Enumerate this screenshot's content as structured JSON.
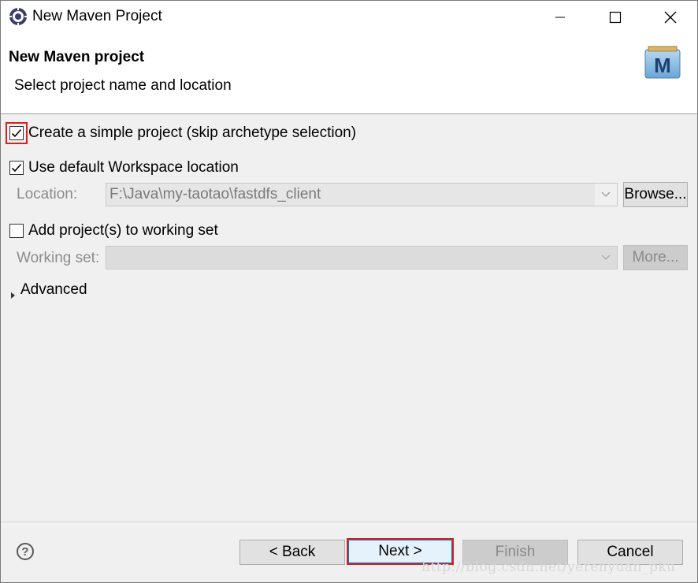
{
  "window": {
    "title": "New Maven Project",
    "controls": {
      "minimize": "—",
      "maximize": "☐",
      "close": "✕"
    }
  },
  "header": {
    "title": "New Maven project",
    "description": "Select project name and location",
    "icon_letter": "M"
  },
  "options": {
    "simple_project": {
      "label": "Create a simple project (skip archetype selection)",
      "checked": true
    },
    "default_workspace": {
      "label": "Use default Workspace location",
      "checked": true
    },
    "location": {
      "label": "Location:",
      "value": "F:\\Java\\my-taotao\\fastdfs_client",
      "browse_label": "Browse..."
    },
    "working_set": {
      "label": "Add project(s) to working set",
      "checked": false
    },
    "working_set_field": {
      "label": "Working set:",
      "value": "",
      "more_label": "More..."
    },
    "advanced": {
      "label": "Advanced"
    }
  },
  "footer": {
    "help": "?",
    "back_label": "< Back",
    "next_label": "Next >",
    "finish_label": "Finish",
    "cancel_label": "Cancel"
  },
  "watermark": "http://blog.csdn.net/yerenyuan_pku",
  "colors": {
    "highlight": "#d8201f",
    "disabled_text": "#8c8c8c",
    "window_bg": "#f0f0f0"
  }
}
